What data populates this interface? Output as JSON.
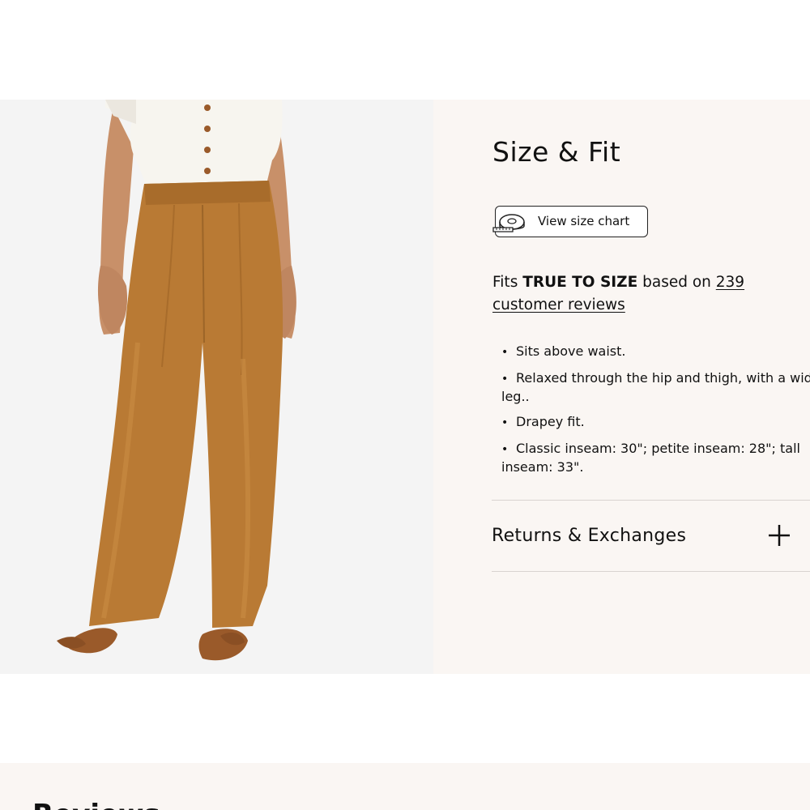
{
  "product": {
    "image_alt": "Model wearing camel wide-leg pleated trousers",
    "colors": {
      "pants": "#b97a34",
      "shoes": "#9a5a2a",
      "top": "#f7f5ef",
      "skin": "#c89069",
      "bg": "#f4f4f4",
      "panel_bg": "#faf6f3"
    }
  },
  "size_fit": {
    "title": "Size & Fit",
    "size_chart_button": "View size chart",
    "size_chart_icon": "measuring-tape-icon",
    "summary_prefix": "Fits ",
    "summary_fit": "TRUE TO SIZE",
    "summary_middle": " based on ",
    "reviews_count": "239",
    "reviews_text": "customer reviews",
    "details": [
      "Sits above waist.",
      "Relaxed through the hip and thigh, with a wide-leg..",
      "Drapey fit.",
      "Classic inseam: 30\"; petite inseam: 28\"; tall inseam: 33\"."
    ]
  },
  "accordion": {
    "returns_label": "Returns & Exchanges",
    "returns_icon": "plus-icon"
  },
  "bottom": {
    "heading": "Reviews"
  }
}
